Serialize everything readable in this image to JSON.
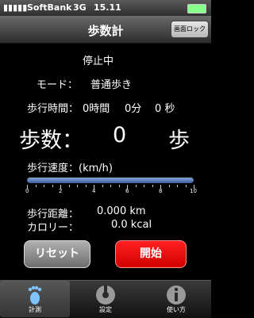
{
  "status": {
    "carrier": "SoftBank",
    "network": "3G",
    "time": "15.11"
  },
  "nav": {
    "title": "歩数計",
    "lock_button": "画面ロック"
  },
  "main": {
    "state": "停止中",
    "mode_label": "モード：",
    "mode_value": "普通歩き",
    "time_label": "歩行時間：",
    "time_hours": "0時間",
    "time_minutes": "0分",
    "time_seconds": "0 秒",
    "steps_label": "歩数：",
    "steps_value": "0",
    "steps_unit": "歩",
    "speed_label": "歩行速度：(km/h)",
    "speed_ticks": [
      "0",
      "2",
      "4",
      "6",
      "8",
      "10"
    ],
    "speed_value": 0,
    "distance_label": "歩行距離：",
    "distance_value": "0.000 km",
    "calorie_label": "カロリー：",
    "calorie_value": "0.0 kcal"
  },
  "buttons": {
    "reset": "リセット",
    "start": "開始"
  },
  "tabs": [
    {
      "label": "計測",
      "icon": "footprint-icon",
      "active": true
    },
    {
      "label": "設定",
      "icon": "wrench-icon",
      "active": false
    },
    {
      "label": "使い方",
      "icon": "info-icon",
      "active": false
    }
  ]
}
